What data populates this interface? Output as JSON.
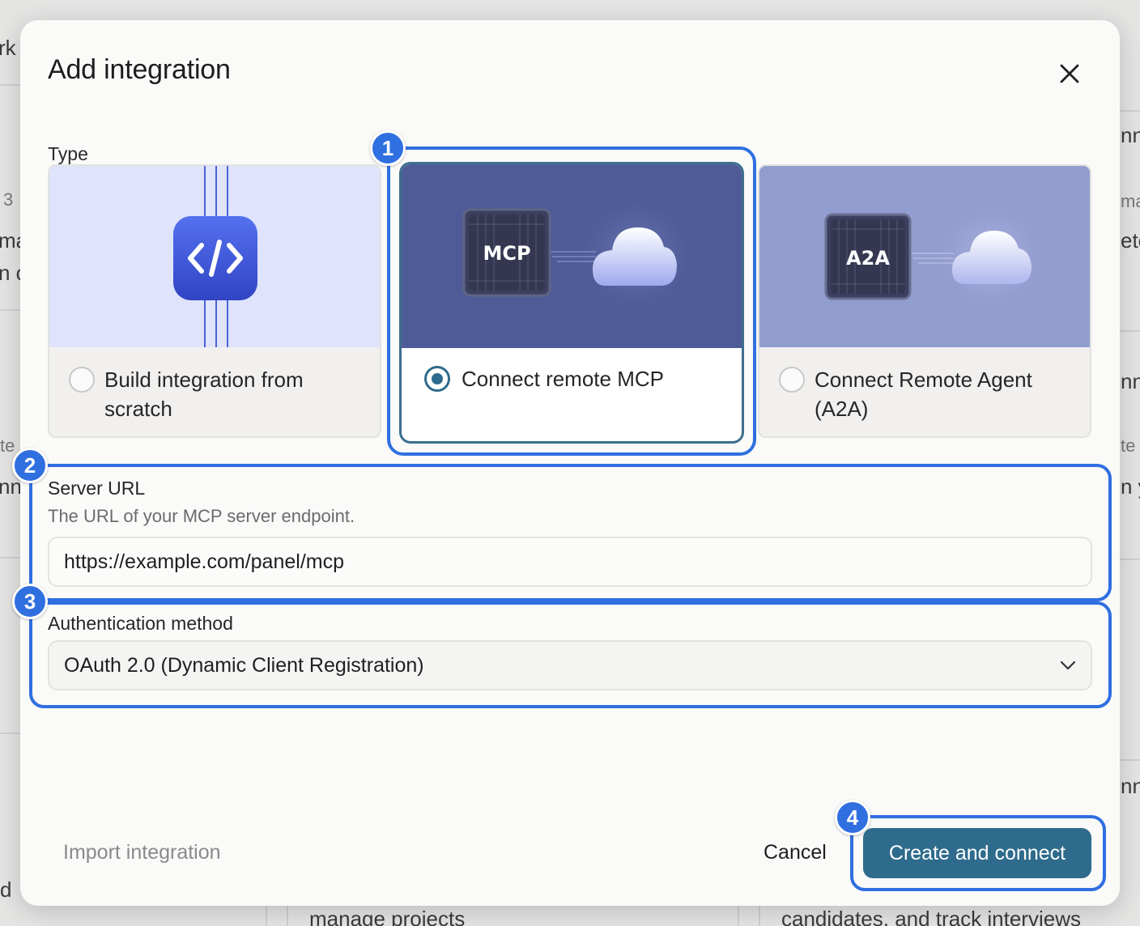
{
  "background": {
    "fragments": [
      "rk",
      "3",
      "ma",
      "n c",
      "te",
      "nn",
      "d",
      "nn",
      "ma",
      "ete",
      "nn",
      "te",
      "n y",
      "nn",
      "manage projects",
      "candidates, and track interviews"
    ]
  },
  "modal": {
    "title": "Add integration",
    "type_label": "Type",
    "cards": [
      {
        "label": "Build integration from scratch",
        "selected": false,
        "icon": "code-icon"
      },
      {
        "label": "Connect remote MCP",
        "selected": true,
        "chip": "MCP",
        "icon": "cloud-icon"
      },
      {
        "label": "Connect Remote Agent (A2A)",
        "selected": false,
        "chip": "A2A",
        "icon": "cloud-icon"
      }
    ],
    "server_url": {
      "label": "Server URL",
      "help": "The URL of your MCP server endpoint.",
      "value": "https://example.com/panel/mcp"
    },
    "auth": {
      "label": "Authentication method",
      "value": "OAuth 2.0 (Dynamic Client Registration)"
    },
    "footer": {
      "import_label": "Import integration",
      "cancel_label": "Cancel",
      "submit_label": "Create and connect"
    }
  },
  "callouts": [
    "1",
    "2",
    "3",
    "4"
  ],
  "colors": {
    "primary": "#2e6b8c",
    "callout": "#2f6fe0",
    "card_scratch_bg": "#dfe3fb",
    "card_mcp_bg": "#4f5b96",
    "card_a2a_bg": "#929dcf"
  }
}
